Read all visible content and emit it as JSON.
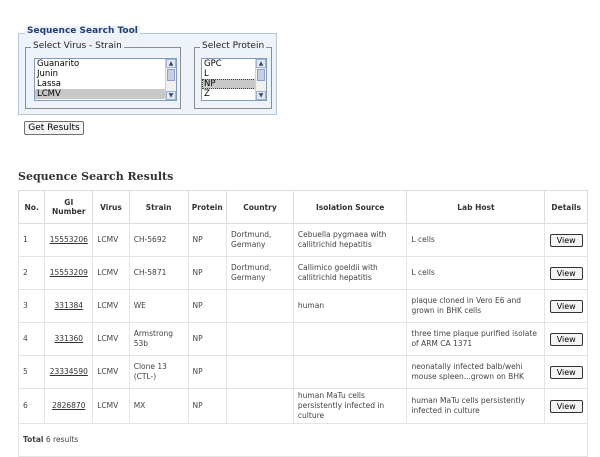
{
  "tool": {
    "title": "Sequence Search Tool",
    "virus_legend": "Select Virus - Strain",
    "virus_options": [
      "Guanarito",
      "Junin",
      "Lassa",
      "LCMV"
    ],
    "virus_selected": "LCMV",
    "protein_legend": "Select Protein",
    "protein_options": [
      "GPC",
      "L",
      "NP",
      "Z"
    ],
    "protein_selected": "NP",
    "get_results_label": "Get Results"
  },
  "results": {
    "title": "Sequence Search Results",
    "columns": [
      "No.",
      "GI Number",
      "Virus",
      "Strain",
      "Protein",
      "Country",
      "Isolation Source",
      "Lab Host",
      "Details"
    ],
    "rows": [
      {
        "no": "1",
        "gi": "15553206",
        "virus": "LCMV",
        "strain": "CH-5692",
        "protein": "NP",
        "country": "Dortmund, Germany",
        "source": "Cebuella pygmaea with callitrichid hepatitis",
        "host": "L cells",
        "details": "View"
      },
      {
        "no": "2",
        "gi": "15553209",
        "virus": "LCMV",
        "strain": "CH-5871",
        "protein": "NP",
        "country": "Dortmund, Germany",
        "source": "Callimico goeldii with callitrichid hepatitis",
        "host": "L cells",
        "details": "View"
      },
      {
        "no": "3",
        "gi": "331384",
        "virus": "LCMV",
        "strain": "WE",
        "protein": "NP",
        "country": "",
        "source": "human",
        "host": "plaque cloned in Vero E6 and grown in BHK cells",
        "details": "View"
      },
      {
        "no": "4",
        "gi": "331360",
        "virus": "LCMV",
        "strain": "Armstrong 53b",
        "protein": "NP",
        "country": "",
        "source": "",
        "host": "three time plaque purified isolate of ARM CA 1371",
        "details": "View"
      },
      {
        "no": "5",
        "gi": "23334590",
        "virus": "LCMV",
        "strain": "Clone 13 (CTL-)",
        "protein": "NP",
        "country": "",
        "source": "",
        "host": "neonatally infected balb/wehi mouse spleen...grown on BHK",
        "details": "View"
      },
      {
        "no": "6",
        "gi": "2826870",
        "virus": "LCMV",
        "strain": "MX",
        "protein": "NP",
        "country": "",
        "source": "human MaTu cells persistently infected in culture",
        "host": "human MaTu cells persistently infected in culture",
        "details": "View"
      }
    ],
    "total_label": "Total",
    "total_value": "6 results"
  }
}
